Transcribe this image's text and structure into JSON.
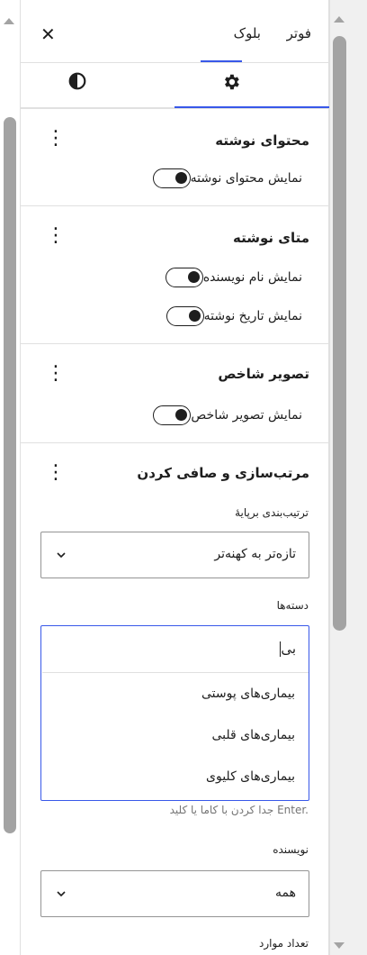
{
  "tabs": {
    "footer": "فوتر",
    "block": "بلوک"
  },
  "icons": {
    "close": "close-icon",
    "settings": "gear-icon",
    "styles": "contrast-icon",
    "more": "kebab-icon",
    "chevron": "chevron-down-icon"
  },
  "sections": {
    "post_content": {
      "title": "محتوای نوشته",
      "toggle_label": "نمایش محتوای نوشته",
      "checked": true
    },
    "post_meta": {
      "title": "متای نوشته",
      "toggles": [
        {
          "label": "نمایش نام نویسنده",
          "checked": true
        },
        {
          "label": "نمایش تاریخ نوشته",
          "checked": true
        }
      ]
    },
    "featured_image": {
      "title": "تصویر شاخص",
      "toggle_label": "نمایش تصویر شاخص",
      "checked": true
    },
    "sorting": {
      "title": "مرتب‌سازی و صافی کردن",
      "order_label": "ترتیب‌بندی برپایهٔ",
      "order_value": "تازه‌تر به کهنه‌تر",
      "categories_label": "دسته‌ها",
      "categories_input": "بی",
      "suggestions": [
        "بیماری‌های پوستی",
        "بیماری‌های قلبی",
        "بیماری‌های کلیوی"
      ],
      "help": "جدا کردن با کاما یا کلید Enter.",
      "author_label": "نویسنده",
      "author_value": "همه",
      "count_label": "تعداد موارد"
    }
  },
  "colors": {
    "accent": "#3858e9",
    "text": "#1e1e1e",
    "border": "#e0e0e0",
    "muted": "#757575"
  }
}
